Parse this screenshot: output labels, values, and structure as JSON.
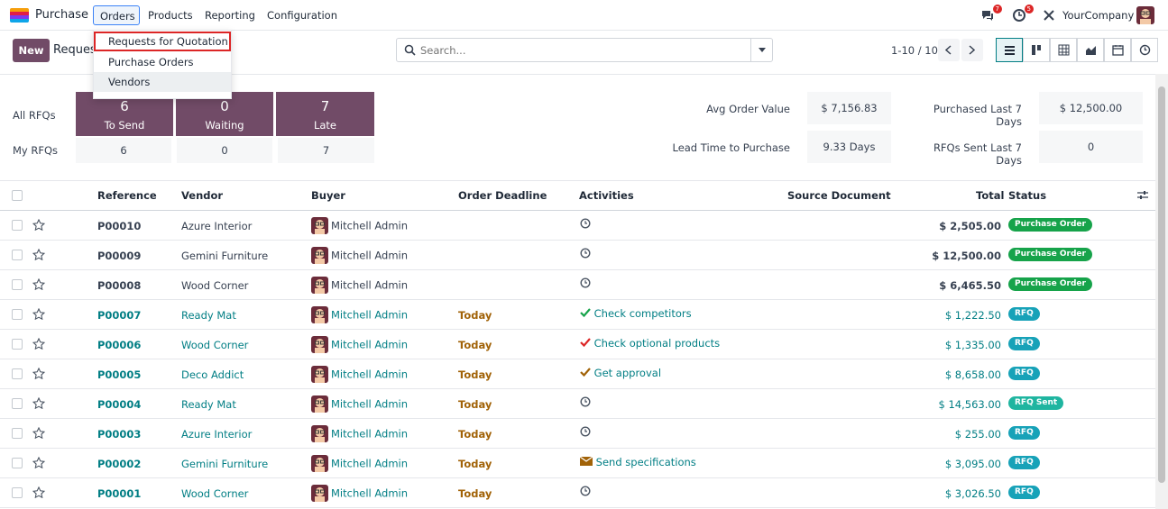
{
  "nav": {
    "app_name": "Purchase",
    "menu": [
      "Orders",
      "Products",
      "Reporting",
      "Configuration"
    ],
    "messages_count": "7",
    "activities_count": "5",
    "company": "YourCompany"
  },
  "dropdown": {
    "items": [
      "Requests for Quotation",
      "Purchase Orders",
      "Vendors"
    ]
  },
  "control": {
    "new_label": "New",
    "breadcrumb": "Requests for Quotation",
    "search_placeholder": "Search...",
    "pager": "1-10 / 10"
  },
  "dashboard": {
    "all_rfqs_label": "All RFQs",
    "my_rfqs_label": "My RFQs",
    "tiles": [
      {
        "num": "6",
        "label": "To Send"
      },
      {
        "num": "0",
        "label": "Waiting"
      },
      {
        "num": "7",
        "label": "Late"
      }
    ],
    "my_values": [
      "6",
      "0",
      "7"
    ],
    "stats": [
      {
        "label": "Avg Order Value",
        "value": "$ 7,156.83"
      },
      {
        "label": "Purchased Last 7 Days",
        "value": "$ 12,500.00"
      },
      {
        "label": "Lead Time to Purchase",
        "value": "9.33 Days"
      },
      {
        "label": "RFQs Sent Last 7 Days",
        "value": "0"
      }
    ]
  },
  "table": {
    "headers": [
      "Reference",
      "Vendor",
      "Buyer",
      "Order Deadline",
      "Activities",
      "Source Document",
      "Total",
      "Status"
    ],
    "rows": [
      {
        "ref": "P00010",
        "vendor": "Azure Interior",
        "buyer": "Mitchell Admin",
        "deadline": "",
        "activity": "",
        "total": "$ 2,505.00",
        "status": "Purchase Order"
      },
      {
        "ref": "P00009",
        "vendor": "Gemini Furniture",
        "buyer": "Mitchell Admin",
        "deadline": "",
        "activity": "",
        "total": "$ 12,500.00",
        "status": "Purchase Order"
      },
      {
        "ref": "P00008",
        "vendor": "Wood Corner",
        "buyer": "Mitchell Admin",
        "deadline": "",
        "activity": "",
        "total": "$ 6,465.50",
        "status": "Purchase Order"
      },
      {
        "ref": "P00007",
        "vendor": "Ready Mat",
        "buyer": "Mitchell Admin",
        "deadline": "Today",
        "activity": "Check competitors",
        "total": "$ 1,222.50",
        "status": "RFQ"
      },
      {
        "ref": "P00006",
        "vendor": "Wood Corner",
        "buyer": "Mitchell Admin",
        "deadline": "Today",
        "activity": "Check optional products",
        "total": "$ 1,335.00",
        "status": "RFQ"
      },
      {
        "ref": "P00005",
        "vendor": "Deco Addict",
        "buyer": "Mitchell Admin",
        "deadline": "Today",
        "activity": "Get approval",
        "total": "$ 8,658.00",
        "status": "RFQ"
      },
      {
        "ref": "P00004",
        "vendor": "Ready Mat",
        "buyer": "Mitchell Admin",
        "deadline": "Today",
        "activity": "",
        "total": "$ 14,563.00",
        "status": "RFQ Sent"
      },
      {
        "ref": "P00003",
        "vendor": "Azure Interior",
        "buyer": "Mitchell Admin",
        "deadline": "Today",
        "activity": "",
        "total": "$ 255.00",
        "status": "RFQ"
      },
      {
        "ref": "P00002",
        "vendor": "Gemini Furniture",
        "buyer": "Mitchell Admin",
        "deadline": "Today",
        "activity": "Send specifications",
        "total": "$ 3,095.00",
        "status": "RFQ"
      },
      {
        "ref": "P00001",
        "vendor": "Wood Corner",
        "buyer": "Mitchell Admin",
        "deadline": "Today",
        "activity": "",
        "total": "$ 3,026.50",
        "status": "RFQ"
      }
    ]
  },
  "colors": {
    "brand": "#714b67",
    "accent": "#017e84",
    "po_green": "#16a34a",
    "rfq_teal": "#17a2b8",
    "rfq_sent": "#1fb5a0",
    "late": "#a16207"
  }
}
